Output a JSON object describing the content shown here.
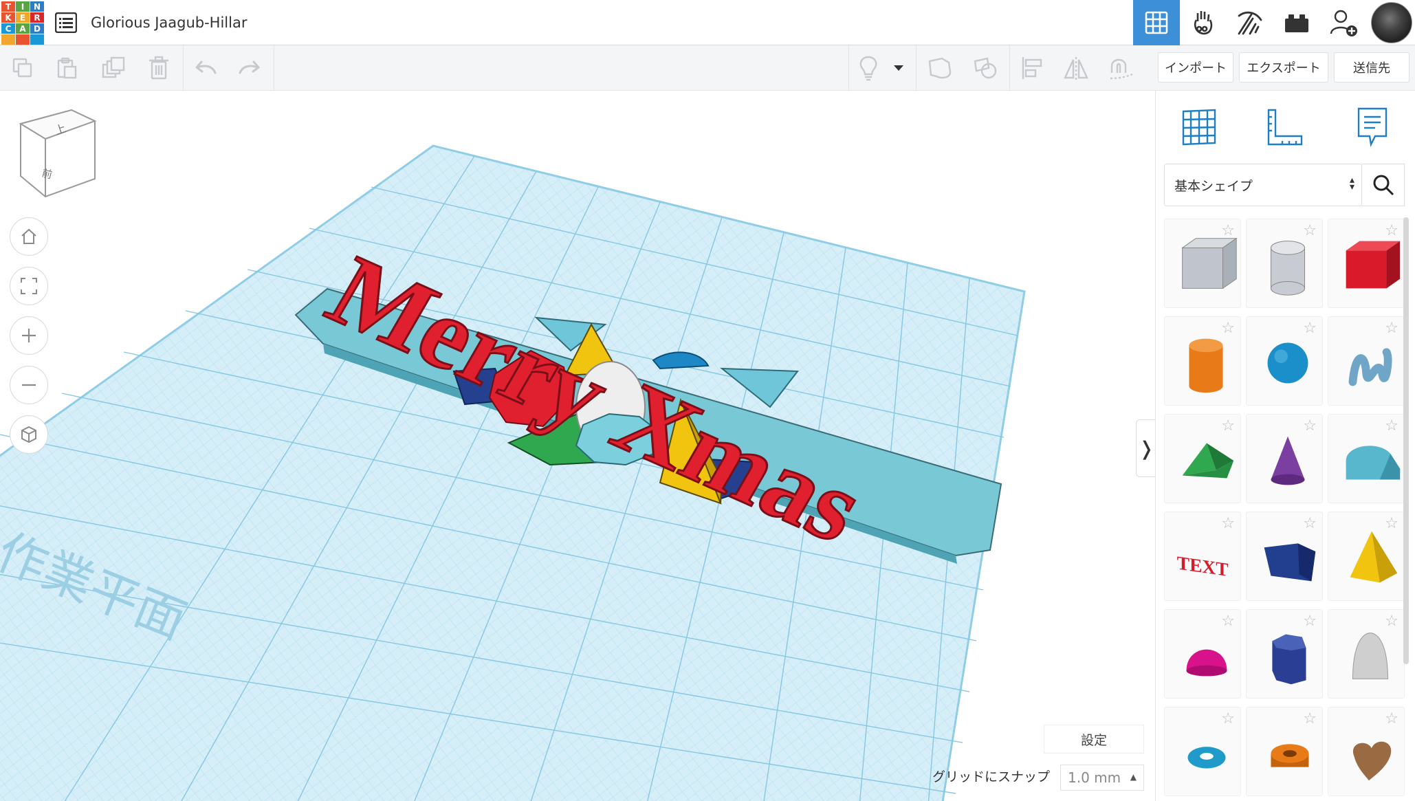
{
  "app": {
    "logo_letters": [
      "T",
      "I",
      "N",
      "K",
      "E",
      "R",
      "C",
      "A",
      "D"
    ],
    "logo_colors": [
      "#e8542f",
      "#5aa443",
      "#2e7cc4",
      "#e8542f",
      "#f0a72c",
      "#d9282a",
      "#1a98d5",
      "#5aa443",
      "#2e7cc4",
      "#f0a72c",
      "#e8542f",
      "#1a98d5"
    ],
    "design_title": "Glorious Jaagub-Hillar",
    "accent": "#3d8fd8"
  },
  "header": {
    "menu_icon": "list-icon",
    "buttons": [
      "grid-view-icon",
      "blocks-icon",
      "lego-icon",
      "brick-icon",
      "add-user-icon"
    ]
  },
  "toolbar": {
    "left_tools": [
      "copy-icon",
      "paste-icon",
      "duplicate-icon",
      "delete-icon",
      "undo-icon",
      "redo-icon"
    ],
    "right_tools": [
      "light-bulb-icon",
      "dropdown-icon",
      "group-icon",
      "ungroup-icon",
      "align-icon",
      "mirror-icon",
      "cruise-icon"
    ],
    "import_label": "インポート",
    "export_label": "エクスポート",
    "send_label": "送信先"
  },
  "viewport": {
    "viewcube_top": "上",
    "viewcube_front": "前",
    "workplane_text": "作業平面",
    "scene_text": "Merry Xmas",
    "settings_label": "設定",
    "snap_label": "グリッドにスナップ",
    "snap_value": "1.0 mm",
    "grid_color": "#9fd3ea",
    "plate_color": "#cfeaf5",
    "text_color": "#e0202e"
  },
  "panel": {
    "tabs": [
      "workplane-icon",
      "ruler-icon",
      "notes-icon"
    ],
    "shape_category": "基本シェイプ",
    "shapes": [
      {
        "name": "box-hole",
        "color": "#c0c4cc"
      },
      {
        "name": "cylinder-hole",
        "color": "#c8ccd2"
      },
      {
        "name": "box",
        "color": "#d91a2a"
      },
      {
        "name": "cylinder",
        "color": "#e87a18"
      },
      {
        "name": "sphere",
        "color": "#1a8fc9"
      },
      {
        "name": "scribble",
        "color": "#6fa6c8"
      },
      {
        "name": "roof",
        "color": "#2fa84f"
      },
      {
        "name": "cone",
        "color": "#7a3fa0"
      },
      {
        "name": "round-roof",
        "color": "#58b7cc"
      },
      {
        "name": "text",
        "color": "#d91a2a"
      },
      {
        "name": "wedge",
        "color": "#223f8f"
      },
      {
        "name": "pyramid",
        "color": "#f1c40f"
      },
      {
        "name": "half-sphere",
        "color": "#d8128a"
      },
      {
        "name": "polygon",
        "color": "#2a3f94"
      },
      {
        "name": "paraboloid",
        "color": "#cfcfcf"
      },
      {
        "name": "torus",
        "color": "#1f9ac9"
      },
      {
        "name": "tube",
        "color": "#e87a18"
      },
      {
        "name": "heart",
        "color": "#9a6b43"
      }
    ]
  }
}
